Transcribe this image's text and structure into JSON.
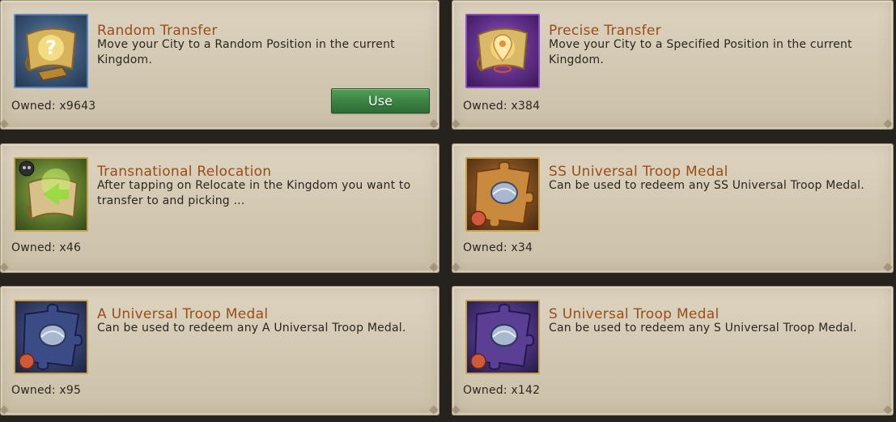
{
  "items": [
    {
      "title": "Random Transfer",
      "description": "Move your City to a Random Position in the current Kingdom.",
      "owned": "Owned: x9643",
      "icon": "scroll-question-icon",
      "has_use_button": true,
      "use_label": "Use"
    },
    {
      "title": "Precise Transfer",
      "description": "Move your City to a Specified Position in the current Kingdom.",
      "owned": "Owned: x384",
      "icon": "scroll-pin-icon"
    },
    {
      "title": "Transnational Relocation",
      "description": "After tapping on Relocate in the Kingdom you want to transfer to and picking ...",
      "owned": "Owned: x46",
      "icon": "scroll-relocation-icon"
    },
    {
      "title": "SS Universal Troop Medal",
      "description": "Can be used to redeem any SS Universal Troop  Medal.",
      "owned": "Owned: x34",
      "icon": "puzzle-medal-icon"
    },
    {
      "title": "A Universal Troop Medal",
      "description": "Can be used to redeem any A Universal Troop Medal.",
      "owned": "Owned: x95",
      "icon": "puzzle-medal-icon"
    },
    {
      "title": "S Universal Troop Medal",
      "description": "Can be used to redeem any S Universal Troop Medal.",
      "owned": "Owned: x142",
      "icon": "puzzle-medal-icon"
    }
  ],
  "colors": {
    "title": "#9a4d17",
    "text": "#2a2620",
    "button": "#3c8444",
    "card": "#d4cab4"
  }
}
